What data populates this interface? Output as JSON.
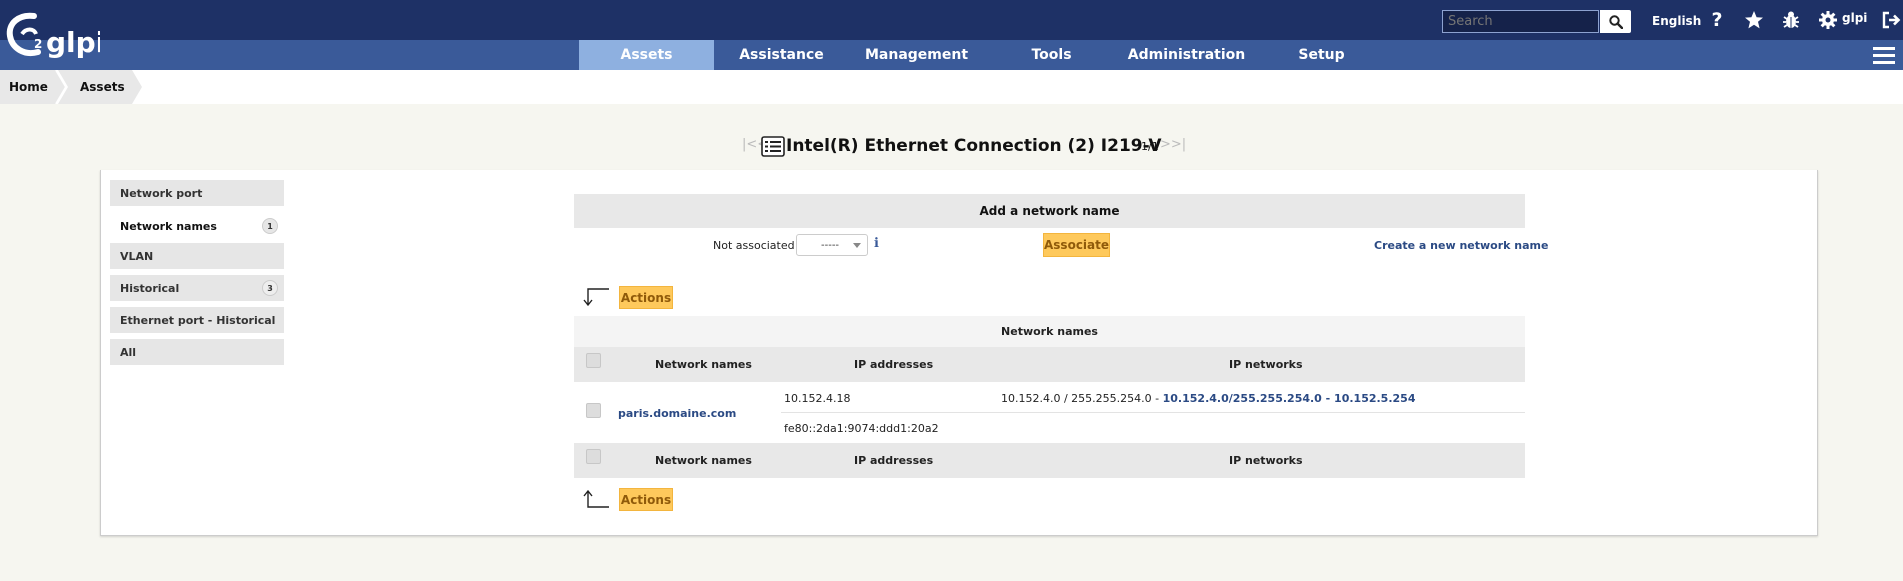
{
  "header": {
    "search_placeholder": "Search",
    "language": "English",
    "user": "glpi",
    "logo_text": "glpi",
    "icons": [
      "search-icon",
      "help-icon",
      "star-icon",
      "bug-icon",
      "gear-icon",
      "logout-icon",
      "hamburger-menu-icon"
    ]
  },
  "menu": {
    "items": [
      {
        "label": "Assets",
        "active": true
      },
      {
        "label": "Assistance"
      },
      {
        "label": "Management"
      },
      {
        "label": "Tools"
      },
      {
        "label": "Administration"
      },
      {
        "label": "Setup"
      }
    ]
  },
  "breadcrumb": [
    "Home",
    "Assets"
  ],
  "title": {
    "text": "Intel(R) Ethernet Connection (2) I219-V",
    "counter": "1/1",
    "nav_first": "|<<",
    "nav_last": ">>|"
  },
  "tabs": [
    {
      "label": "Network port"
    },
    {
      "label": "Network names",
      "badge": "1",
      "active": true
    },
    {
      "label": "VLAN"
    },
    {
      "label": "Historical",
      "badge": "3"
    },
    {
      "label": "Ethernet port - Historical"
    },
    {
      "label": "All"
    }
  ],
  "add_section": {
    "header": "Add a network name",
    "not_associated": "Not associated",
    "select_value": "-----",
    "info": "ℹ",
    "associate_label": "Associate",
    "create_label": "Create a new network name"
  },
  "actions_label": "Actions",
  "table": {
    "caption": "Network names",
    "columns": [
      "Network names",
      "IP addresses",
      "IP networks"
    ],
    "row": {
      "name": "paris.domaine.com",
      "ips": [
        "10.152.4.18",
        "fe80::2da1:9074:ddd1:20a2"
      ],
      "network_prefix": "10.152.4.0 / 255.255.254.0 - ",
      "network_link": "10.152.4.0/255.255.254.0 - 10.152.5.254"
    }
  },
  "colors": {
    "topbar": "#1e3166",
    "menubar": "#3a5a99",
    "active_menu": "#8eb0e0",
    "action_button": "#fec95c",
    "link": "#2b4a84"
  }
}
